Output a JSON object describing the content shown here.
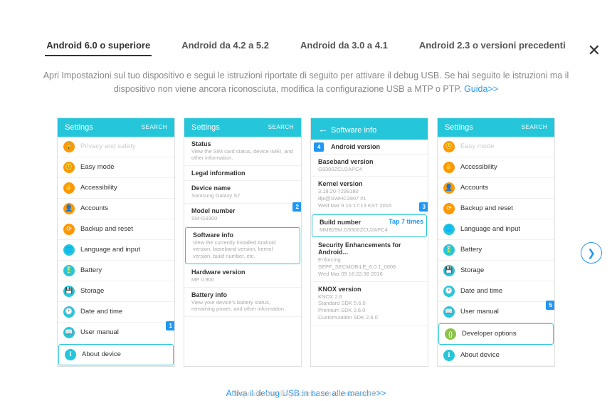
{
  "close": "✕",
  "tabs": [
    {
      "label": "Android 6.0 o superiore",
      "active": true
    },
    {
      "label": "Android da 4.2 a 5.2",
      "active": false
    },
    {
      "label": "Android da 3.0 a 4.1",
      "active": false
    },
    {
      "label": "Android 2.3 o versioni precedenti",
      "active": false
    }
  ],
  "instructionText": "Apri Impostazioni sul tuo dispositivo e segui le istruzioni riportate di seguito per attivare il debug USB. Se hai seguito le istruzioni ma il dispositivo non viene ancora riconosciuta, modifica la configurazione USB a MTP o PTP. ",
  "instructionLink": "Guida>>",
  "searchLabel": "SEARCH",
  "panel1": {
    "header": "Settings",
    "items": [
      {
        "icon": "ic-orange",
        "glyph": "🔒",
        "text": "Privacy and safety",
        "dim": true
      },
      {
        "icon": "ic-orange",
        "glyph": "😊",
        "text": "Easy mode"
      },
      {
        "icon": "ic-orange",
        "glyph": "✋",
        "text": "Accessibility"
      },
      {
        "icon": "ic-orange",
        "glyph": "👤",
        "text": "Accounts"
      },
      {
        "icon": "ic-orange",
        "glyph": "⟳",
        "text": "Backup and reset"
      },
      {
        "icon": "ic-cyan",
        "glyph": "🌐",
        "text": "Language and input"
      },
      {
        "icon": "ic-cyan",
        "glyph": "🔋",
        "text": "Battery"
      },
      {
        "icon": "ic-cyan",
        "glyph": "💾",
        "text": "Storage"
      },
      {
        "icon": "ic-cyan",
        "glyph": "🕐",
        "text": "Date and time"
      },
      {
        "icon": "ic-cyan",
        "glyph": "📖",
        "text": "User manual"
      },
      {
        "icon": "ic-cyan",
        "glyph": "ℹ",
        "text": "About device",
        "highlight": true
      }
    ],
    "badge": "1"
  },
  "panel2": {
    "header": "Settings",
    "items": [
      {
        "title": "Status",
        "sub": "View the SIM card status, device IMEI, and other information."
      },
      {
        "title": "Legal information",
        "sub": ""
      },
      {
        "title": "Device name",
        "sub": "Samsung Galaxy S7"
      },
      {
        "title": "Model number",
        "sub": "SM-G9300"
      },
      {
        "title": "Software info",
        "sub": "View the currently installed Android version, baseband version, kernel version, build number, etc.",
        "highlight": true
      },
      {
        "title": "Hardware version",
        "sub": "MP 0.900"
      },
      {
        "title": "Battery info",
        "sub": "View your device's battery status, remaining power, and other information."
      }
    ],
    "badge": "2"
  },
  "panel3": {
    "header": "Software info",
    "items": [
      {
        "title": "Android version",
        "sub": "",
        "badgeLeft": "4"
      },
      {
        "title": "Baseband version",
        "sub": "G9300ZCU2APC4"
      },
      {
        "title": "Kernel version",
        "sub": "3.18.20-7299180\ndpi@SWHC3907 #1\nWed Mar 9 16:17:13 KST 2016",
        "badgeRight": "3"
      },
      {
        "title": "Build number",
        "sub": "MMB29M.G9300ZCU2APC4",
        "highlight": true,
        "tap": "Tap 7 times"
      },
      {
        "title": "Security Enhancements for Android...",
        "sub": "Enforcing\nSEPF_SECMOBILE_6.0.1_0006\nWed Mar 09 16:22:38 2016"
      },
      {
        "title": "KNOX version",
        "sub": "KNOX 2.6\nStandard SDK 5.6.0\nPremium SDK 2.6.0\nCustomization SDK 2.6.0"
      }
    ]
  },
  "panel4": {
    "header": "Settings",
    "items": [
      {
        "icon": "ic-orange",
        "glyph": "😊",
        "text": "Easy mode",
        "dim": true
      },
      {
        "icon": "ic-orange",
        "glyph": "✋",
        "text": "Accessibility"
      },
      {
        "icon": "ic-orange",
        "glyph": "👤",
        "text": "Accounts"
      },
      {
        "icon": "ic-orange",
        "glyph": "⟳",
        "text": "Backup and reset"
      },
      {
        "icon": "ic-cyan",
        "glyph": "🌐",
        "text": "Language and input"
      },
      {
        "icon": "ic-cyan",
        "glyph": "🔋",
        "text": "Battery"
      },
      {
        "icon": "ic-cyan",
        "glyph": "💾",
        "text": "Storage"
      },
      {
        "icon": "ic-cyan",
        "glyph": "🕐",
        "text": "Date and time"
      },
      {
        "icon": "ic-cyan",
        "glyph": "📖",
        "text": "User manual"
      },
      {
        "icon": "ic-green",
        "glyph": "{}",
        "text": "Developer options",
        "highlight": true
      },
      {
        "icon": "ic-cyan",
        "glyph": "ℹ",
        "text": "About device"
      }
    ],
    "badge": "5"
  },
  "navNext": "❯",
  "footerLink": "Attiva il debug USB in base alle marche>>",
  "bottomText": "Dispositivo collegato ma non riconosciuto?"
}
